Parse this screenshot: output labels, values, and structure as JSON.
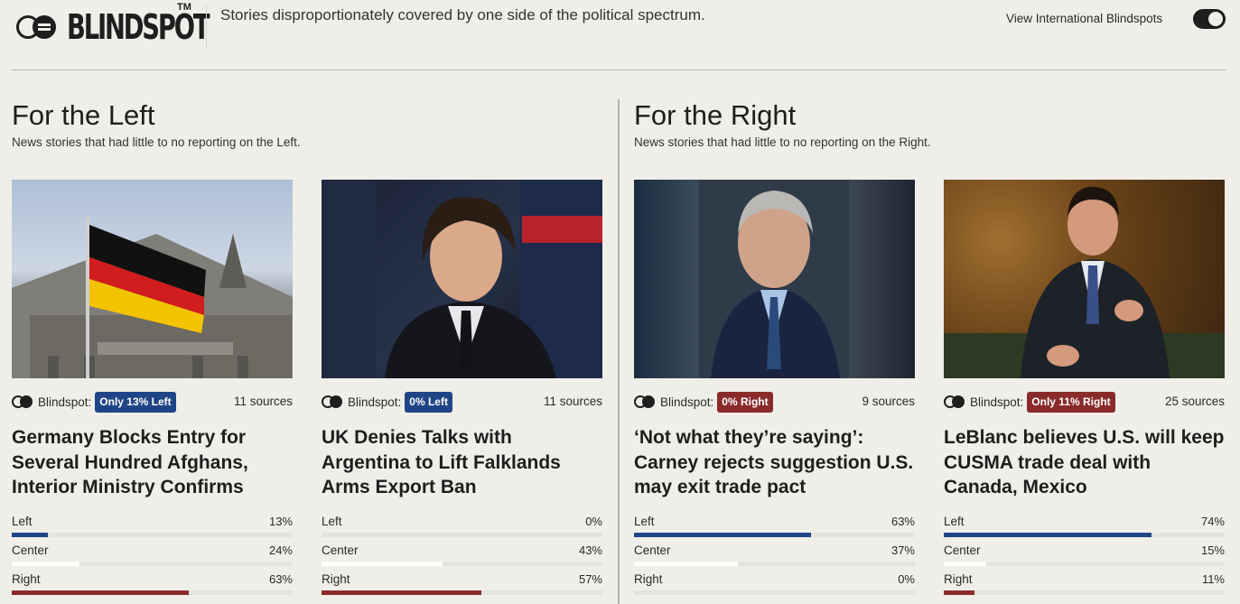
{
  "header": {
    "logo_text": "BLINDSPOT",
    "logo_tm": "TM",
    "tagline": "Stories disproportionately covered by one side of the political spectrum.",
    "intl_toggle_label": "View International Blindspots",
    "intl_toggle_on": true
  },
  "sections": [
    {
      "title": "For the Left",
      "subtitle": "News stories that had little to no reporting on the Left."
    },
    {
      "title": "For the Right",
      "subtitle": "News stories that had little to no reporting on the Right."
    }
  ],
  "cards": [
    {
      "image_icon": "german-flag-reichstag-photo",
      "blindspot_label": "Blindspot:",
      "badge": "Only 13% Left",
      "badge_side": "left",
      "sources": "11 sources",
      "headline": "Germany Blocks Entry for Several Hundred Afghans, Interior Ministry Confirms",
      "bias": [
        {
          "label": "Left",
          "pct": "13%",
          "value": 13
        },
        {
          "label": "Center",
          "pct": "24%",
          "value": 24
        },
        {
          "label": "Right",
          "pct": "63%",
          "value": 63
        }
      ]
    },
    {
      "image_icon": "man-in-suit-photo",
      "blindspot_label": "Blindspot:",
      "badge": "0% Left",
      "badge_side": "left",
      "sources": "11 sources",
      "headline": "UK Denies Talks with Argentina to Lift Falklands Arms Export Ban",
      "bias": [
        {
          "label": "Left",
          "pct": "0%",
          "value": 0
        },
        {
          "label": "Center",
          "pct": "43%",
          "value": 43
        },
        {
          "label": "Right",
          "pct": "57%",
          "value": 57
        }
      ]
    },
    {
      "image_icon": "grey-haired-man-portrait-photo",
      "blindspot_label": "Blindspot:",
      "badge": "0% Right",
      "badge_side": "right",
      "sources": "9 sources",
      "headline": "‘Not what they’re saying’: Carney rejects suggestion U.S. may exit trade pact",
      "bias": [
        {
          "label": "Left",
          "pct": "63%",
          "value": 63
        },
        {
          "label": "Center",
          "pct": "37%",
          "value": 37
        },
        {
          "label": "Right",
          "pct": "0%",
          "value": 0
        }
      ]
    },
    {
      "image_icon": "man-speaking-in-parliament-photo",
      "blindspot_label": "Blindspot:",
      "badge": "Only 11% Right",
      "badge_side": "right",
      "sources": "25 sources",
      "headline": "LeBlanc believes U.S. will keep CUSMA trade deal with Canada, Mexico",
      "bias": [
        {
          "label": "Left",
          "pct": "74%",
          "value": 74
        },
        {
          "label": "Center",
          "pct": "15%",
          "value": 15
        },
        {
          "label": "Right",
          "pct": "11%",
          "value": 11
        }
      ]
    }
  ]
}
